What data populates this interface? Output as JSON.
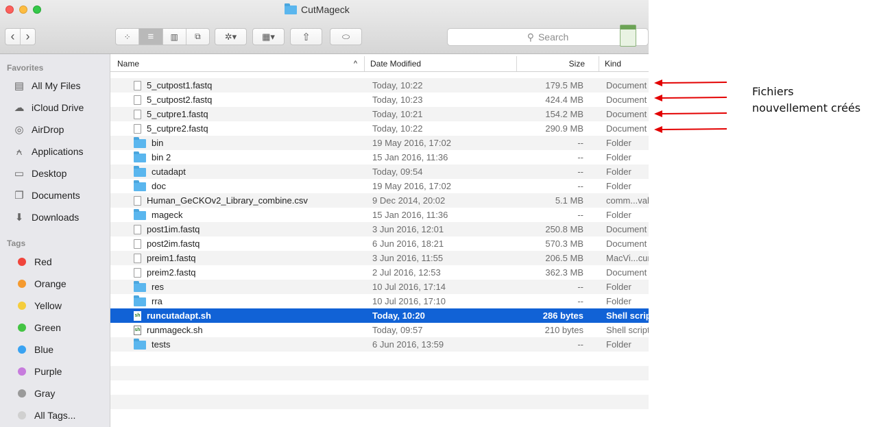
{
  "window": {
    "title": "CutMageck"
  },
  "toolbar": {
    "back_glyph": "‹",
    "forward_glyph": "›",
    "view_icon_glyph": "⁘",
    "view_list_glyph": "≡",
    "view_column_glyph": "▥",
    "view_cover_glyph": "⧉",
    "action_glyph": "✲▾",
    "arrange_glyph": "▦▾",
    "share_glyph": "⇧",
    "tag_glyph": "⬭",
    "search_glyph": "⚲",
    "search_placeholder": "Search"
  },
  "sidebar": {
    "favorites_label": "Favorites",
    "favorites": [
      {
        "label": "All My Files",
        "icon": "all-files-icon",
        "glyph": "▤"
      },
      {
        "label": "iCloud Drive",
        "icon": "cloud-icon",
        "glyph": "☁"
      },
      {
        "label": "AirDrop",
        "icon": "airdrop-icon",
        "glyph": "◎"
      },
      {
        "label": "Applications",
        "icon": "applications-icon",
        "glyph": "⍲"
      },
      {
        "label": "Desktop",
        "icon": "desktop-icon",
        "glyph": "▭"
      },
      {
        "label": "Documents",
        "icon": "documents-icon",
        "glyph": "❐"
      },
      {
        "label": "Downloads",
        "icon": "downloads-icon",
        "glyph": "⬇"
      }
    ],
    "tags_label": "Tags",
    "tags": [
      {
        "label": "Red",
        "color": "#f0453c"
      },
      {
        "label": "Orange",
        "color": "#f59a2f"
      },
      {
        "label": "Yellow",
        "color": "#f5cd3c"
      },
      {
        "label": "Green",
        "color": "#43c443"
      },
      {
        "label": "Blue",
        "color": "#3aa3f2"
      },
      {
        "label": "Purple",
        "color": "#c77cdd"
      },
      {
        "label": "Gray",
        "color": "#9a9a9a"
      },
      {
        "label": "All Tags...",
        "color": "#d0d0d0"
      }
    ]
  },
  "columns": {
    "name": "Name",
    "sort_glyph": "^",
    "date": "Date Modified",
    "size": "Size",
    "kind": "Kind"
  },
  "files": [
    {
      "name": "5_cutpost1.fastq",
      "date": "Today, 10:22",
      "size": "179.5 MB",
      "kind": "Document",
      "type": "file"
    },
    {
      "name": "5_cutpost2.fastq",
      "date": "Today, 10:23",
      "size": "424.4 MB",
      "kind": "Document",
      "type": "file"
    },
    {
      "name": "5_cutpre1.fastq",
      "date": "Today, 10:21",
      "size": "154.2 MB",
      "kind": "Document",
      "type": "file"
    },
    {
      "name": "5_cutpre2.fastq",
      "date": "Today, 10:22",
      "size": "290.9 MB",
      "kind": "Document",
      "type": "file"
    },
    {
      "name": "bin",
      "date": "19 May 2016, 17:02",
      "size": "--",
      "kind": "Folder",
      "type": "folder"
    },
    {
      "name": "bin 2",
      "date": "15 Jan 2016, 11:36",
      "size": "--",
      "kind": "Folder",
      "type": "folder"
    },
    {
      "name": "cutadapt",
      "date": "Today, 09:54",
      "size": "--",
      "kind": "Folder",
      "type": "folder"
    },
    {
      "name": "doc",
      "date": "19 May 2016, 17:02",
      "size": "--",
      "kind": "Folder",
      "type": "folder"
    },
    {
      "name": "Human_GeCKOv2_Library_combine.csv",
      "date": "9 Dec 2014, 20:02",
      "size": "5.1 MB",
      "kind": "comm...values",
      "type": "file"
    },
    {
      "name": "mageck",
      "date": "15 Jan 2016, 11:36",
      "size": "--",
      "kind": "Folder",
      "type": "folder"
    },
    {
      "name": "post1im.fastq",
      "date": "3 Jun 2016, 12:01",
      "size": "250.8 MB",
      "kind": "Document",
      "type": "file"
    },
    {
      "name": "post2im.fastq",
      "date": "6 Jun 2016, 18:21",
      "size": "570.3 MB",
      "kind": "Document",
      "type": "file"
    },
    {
      "name": "preim1.fastq",
      "date": "3 Jun 2016, 11:55",
      "size": "206.5 MB",
      "kind": "MacVi...cument",
      "type": "file"
    },
    {
      "name": "preim2.fastq",
      "date": "2 Jul 2016, 12:53",
      "size": "362.3 MB",
      "kind": "Document",
      "type": "file"
    },
    {
      "name": "res",
      "date": "10 Jul 2016, 17:14",
      "size": "--",
      "kind": "Folder",
      "type": "folder"
    },
    {
      "name": "rra",
      "date": "10 Jul 2016, 17:10",
      "size": "--",
      "kind": "Folder",
      "type": "folder"
    },
    {
      "name": "runcutadapt.sh",
      "date": "Today, 10:20",
      "size": "286 bytes",
      "kind": "Shell script",
      "type": "script",
      "selected": true
    },
    {
      "name": "runmageck.sh",
      "date": "Today, 09:57",
      "size": "210 bytes",
      "kind": "Shell script",
      "type": "script"
    },
    {
      "name": "tests",
      "date": "6 Jun 2016, 13:59",
      "size": "--",
      "kind": "Folder",
      "type": "folder"
    }
  ],
  "script_icon_text": "sh",
  "annotation": {
    "line1": "Fichiers",
    "line2": "nouvellement créés",
    "arrow_color": "#e30000"
  }
}
